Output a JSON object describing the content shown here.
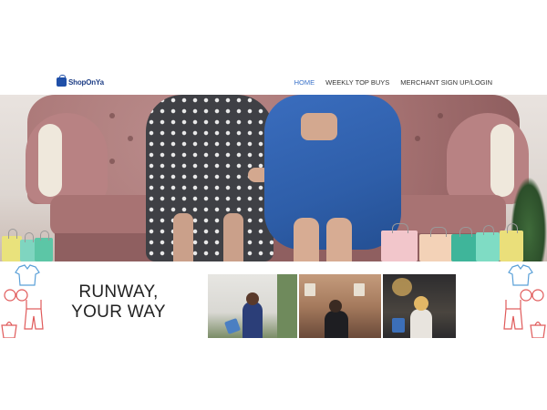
{
  "brand": {
    "name": "ShopOnYa",
    "icon": "shopping-bag-icon"
  },
  "nav": {
    "items": [
      {
        "label": "HOME",
        "active": true
      },
      {
        "label": "WEEKLY TOP BUYS",
        "active": false
      },
      {
        "label": "MERCHANT SIGN UP/LOGIN",
        "active": false
      }
    ]
  },
  "hero": {
    "image": "two-women-on-pink-tufted-sofa-with-shopping-bags"
  },
  "promo": {
    "headline_line1": "RUNWAY,",
    "headline_line2": "YOUR WAY",
    "gallery": [
      {
        "image": "woman-with-shopping-bag-street"
      },
      {
        "image": "woman-in-sunglasses-city"
      },
      {
        "image": "woman-shopping-with-bags"
      }
    ]
  },
  "colors": {
    "brand": "#1f3f86",
    "nav_active": "#3a72c9",
    "nav_text": "#333333",
    "sketch_blue": "#5aa0d8",
    "sketch_red": "#e05a5a"
  }
}
